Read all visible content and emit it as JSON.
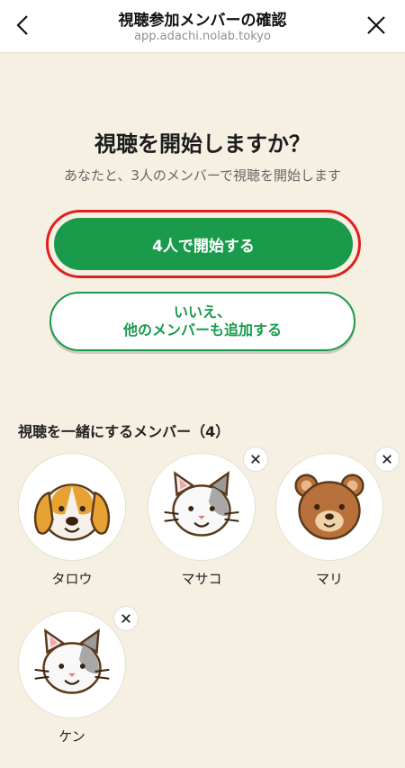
{
  "header": {
    "title": "視聴参加メンバーの確認",
    "url": "app.adachi.nolab.tokyo"
  },
  "main": {
    "heading": "視聴を開始しますか？",
    "subtext": "あなたと、3人のメンバーで視聴を開始します",
    "primary_button": "4人で開始する",
    "secondary_button_line1": "いいえ、",
    "secondary_button_line2": "他のメンバーも追加する"
  },
  "members": {
    "title": "視聴を一緒にするメンバー（4）",
    "items": [
      {
        "name": "タロウ",
        "icon": "dog-avatar-icon",
        "removable": false
      },
      {
        "name": "マサコ",
        "icon": "cat-avatar-icon",
        "removable": true
      },
      {
        "name": "マリ",
        "icon": "bear-avatar-icon",
        "removable": true
      },
      {
        "name": "ケン",
        "icon": "cat-avatar-icon",
        "removable": true
      }
    ]
  },
  "colors": {
    "accent_green": "#1a9b4b",
    "highlight_red": "#e02020",
    "background": "#f5f0e1"
  }
}
